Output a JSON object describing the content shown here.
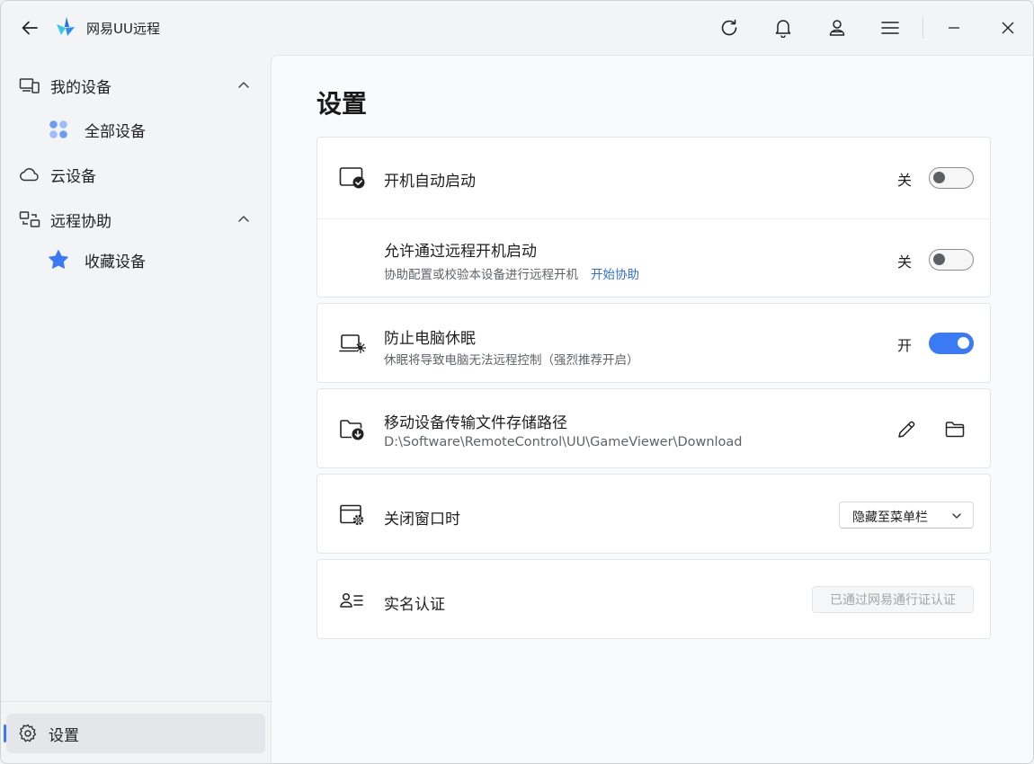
{
  "app": {
    "title": "网易UU远程",
    "accent_color": "#3a7bf5"
  },
  "titlebar": {
    "icons": [
      "back-arrow-icon",
      "refresh-icon",
      "bell-icon",
      "user-icon",
      "menu-icon",
      "minimize-icon",
      "close-icon"
    ]
  },
  "sidebar": {
    "items": [
      {
        "label": "我的设备",
        "icon": "devices-icon",
        "expanded": true
      },
      {
        "label": "全部设备",
        "icon": "grid-dots-icon"
      },
      {
        "label": "云设备",
        "icon": "cloud-icon"
      },
      {
        "label": "远程协助",
        "icon": "remote-assist-icon",
        "expanded": true
      },
      {
        "label": "收藏设备",
        "icon": "star-icon"
      }
    ],
    "footer": {
      "label": "设置",
      "icon": "gear-icon",
      "active": true
    }
  },
  "main": {
    "title": "设置",
    "auto_start": {
      "title": "开机自动启动",
      "state_label": "关",
      "on": false
    },
    "remote_boot": {
      "title": "允许通过远程开机启动",
      "subtitle": "协助配置或校验本设备进行远程开机",
      "link": "开始协助",
      "state_label": "关",
      "on": false
    },
    "prevent_sleep": {
      "title": "防止电脑休眠",
      "subtitle": "休眠将导致电脑无法远程控制（强烈推荐开启）",
      "state_label": "开",
      "on": true
    },
    "storage_path": {
      "title": "移动设备传输文件存储路径",
      "path": "D:\\Software\\RemoteControl\\UU\\GameViewer\\Download"
    },
    "close_window": {
      "title": "关闭窗口时",
      "selected": "隐藏至菜单栏"
    },
    "real_name": {
      "title": "实名认证",
      "button": "已通过网易通行证认证"
    }
  }
}
